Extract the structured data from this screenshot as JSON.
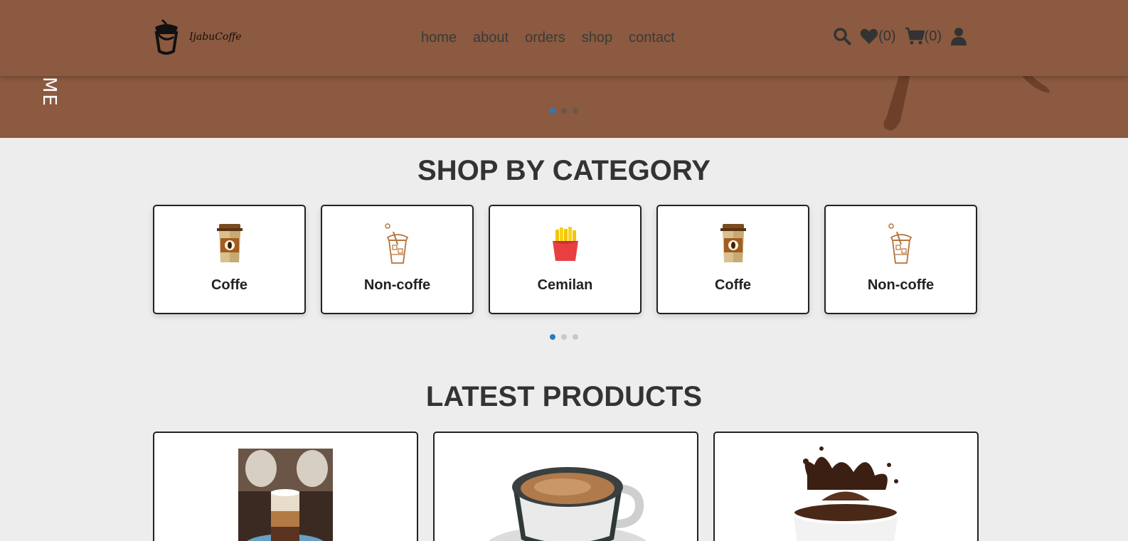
{
  "header": {
    "logo_text": "IjabuCoffe",
    "nav": [
      "home",
      "about",
      "orders",
      "shop",
      "contact"
    ],
    "wishlist_count": "(0)",
    "cart_count": "(0)"
  },
  "hero": {
    "vertical_text": "ME",
    "active_slide": 1,
    "slide_count": 3
  },
  "categories": {
    "title": "SHOP BY CATEGORY",
    "items": [
      {
        "label": "Coffe",
        "icon": "coffee-cup-icon"
      },
      {
        "label": "Non-coffe",
        "icon": "iced-drink-icon"
      },
      {
        "label": "Cemilan",
        "icon": "fries-icon"
      },
      {
        "label": "Coffe",
        "icon": "coffee-cup-icon"
      },
      {
        "label": "Non-coffe",
        "icon": "iced-drink-icon"
      }
    ],
    "active_slide": 1,
    "slide_count": 3
  },
  "latest": {
    "title": "LATEST PRODUCTS"
  },
  "colors": {
    "header_bg": "#8b5a40",
    "page_bg": "#ededed",
    "accent_dot": "#2a7bbd"
  }
}
